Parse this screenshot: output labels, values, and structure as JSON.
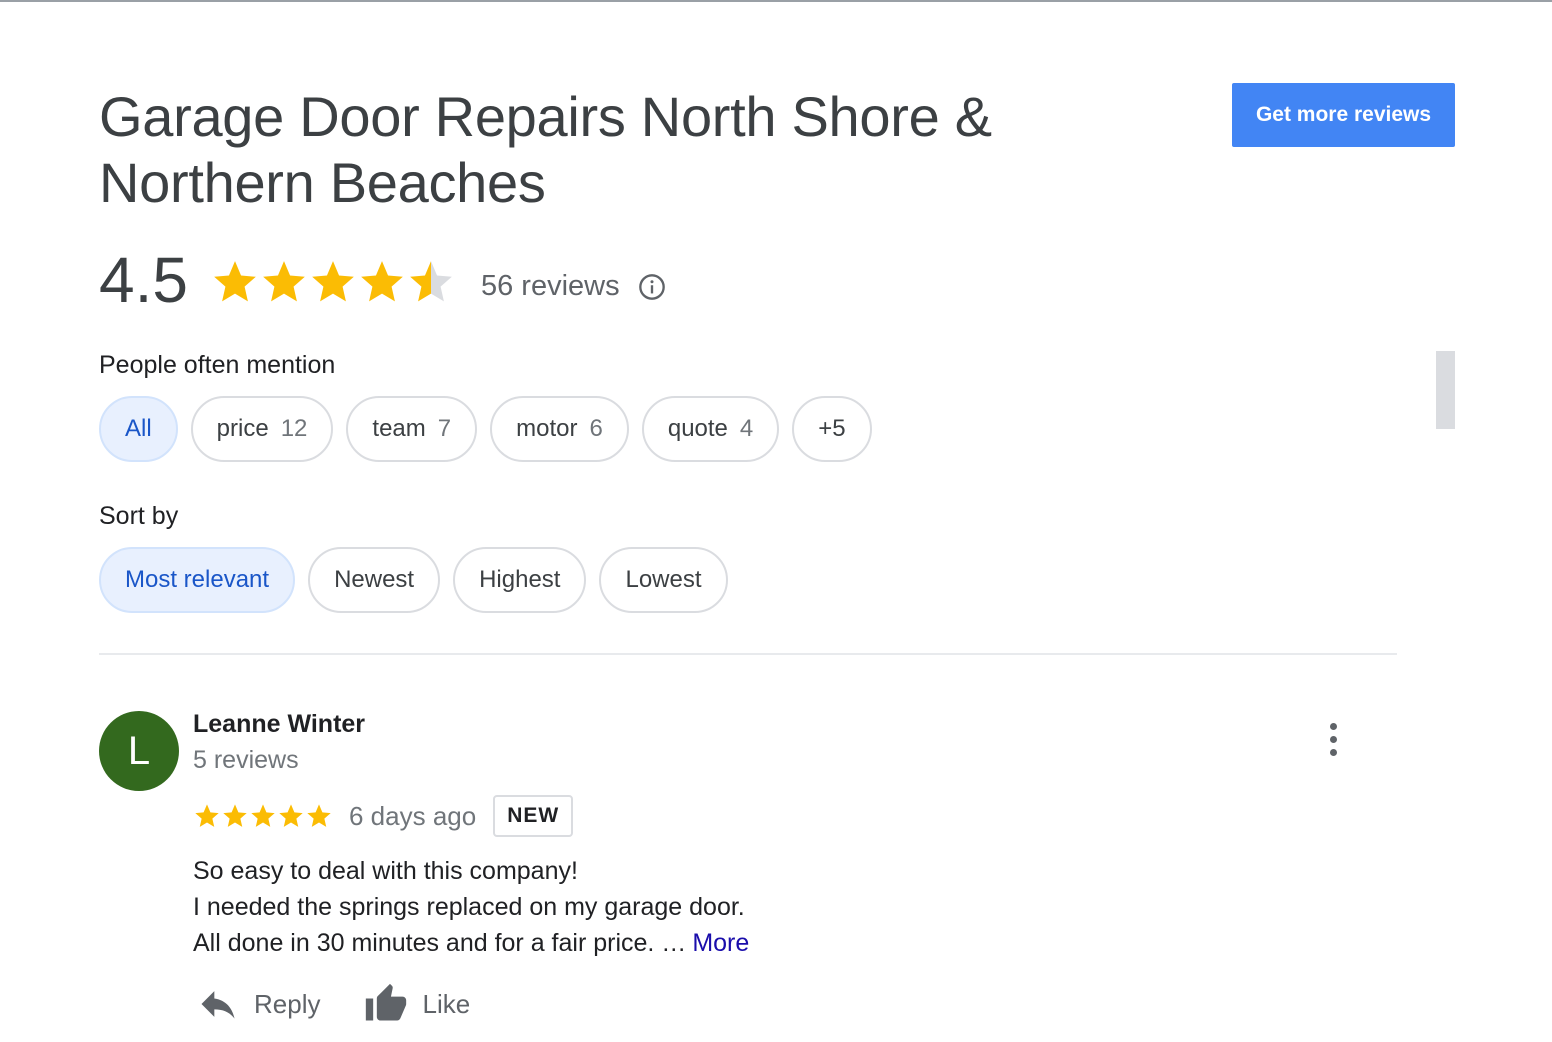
{
  "business": {
    "title_line1": "Garage Door Repairs North Shore &",
    "title_line2": "Northern Beaches",
    "cta_label": "Get more reviews"
  },
  "rating": {
    "value": "4.5",
    "stars_filled_fraction": 0.9,
    "review_count": "56 reviews",
    "info_icon": "info-icon"
  },
  "people_often_mention": {
    "label": "People often mention",
    "chips": [
      {
        "label": "All",
        "count": "",
        "selected": true
      },
      {
        "label": "price",
        "count": "12"
      },
      {
        "label": "team",
        "count": "7"
      },
      {
        "label": "motor",
        "count": "6"
      },
      {
        "label": "quote",
        "count": "4"
      },
      {
        "label": "+5",
        "count": ""
      }
    ]
  },
  "sort_by": {
    "label": "Sort by",
    "options": [
      {
        "label": "Most relevant",
        "selected": true
      },
      {
        "label": "Newest"
      },
      {
        "label": "Highest"
      },
      {
        "label": "Lowest"
      }
    ]
  },
  "review": {
    "avatar_initial": "L",
    "reviewer_name": "Leanne Winter",
    "reviewer_meta": "5 reviews",
    "stars": 5,
    "date": "6 days ago",
    "badge": "NEW",
    "text_lines": [
      "So easy to deal with this company!",
      "I needed the springs replaced on my garage door.",
      "All done in 30 minutes and for a fair price. …"
    ],
    "more_label": "More",
    "reply_label": "Reply",
    "like_label": "Like"
  },
  "colors": {
    "star": "#fbbc04",
    "star_empty": "#dadce0",
    "cta_bg": "#4285f4",
    "chip_selected_bg": "#e8f0fe",
    "avatar_bg": "#33691e",
    "link": "#1a0dab"
  }
}
